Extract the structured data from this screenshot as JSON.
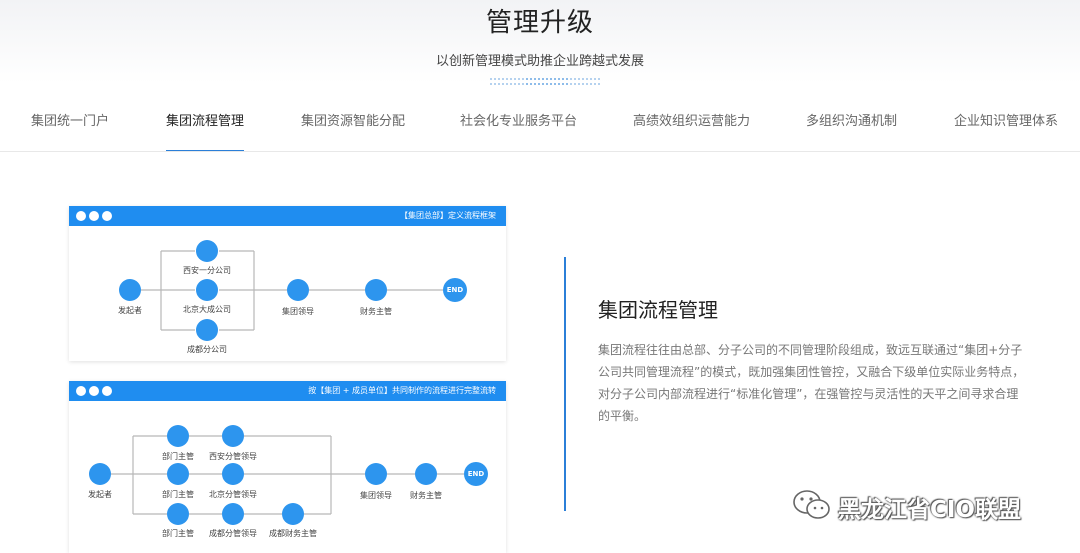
{
  "header": {
    "title": "管理升级",
    "subtitle": "以创新管理模式助推企业跨越式发展"
  },
  "tabs": [
    {
      "label": "集团统一门户",
      "active": false
    },
    {
      "label": "集团流程管理",
      "active": true
    },
    {
      "label": "集团资源智能分配",
      "active": false
    },
    {
      "label": "社会化专业服务平台",
      "active": false
    },
    {
      "label": "高绩效组织运营能力",
      "active": false
    },
    {
      "label": "多组织沟通机制",
      "active": false
    },
    {
      "label": "企业知识管理体系",
      "active": false
    }
  ],
  "diagram1": {
    "bar_title": "【集团总部】定义流程框架",
    "start_label": "发起者",
    "branches": [
      "西安一分公司",
      "北京大成公司",
      "成都分公司"
    ],
    "leader_label": "集团领导",
    "finance_label": "财务主管",
    "end_label": "END"
  },
  "diagram2": {
    "bar_title": "按【集团 + 成员单位】共同制作的流程进行完整流转",
    "start_label": "发起者",
    "row1": [
      "部门主管",
      "西安分管领导"
    ],
    "row2": [
      "部门主管",
      "北京分管领导"
    ],
    "row3": [
      "部门主管",
      "成都分管领导",
      "成都财务主管"
    ],
    "leader_label": "集团领导",
    "finance_label": "财务主管",
    "end_label": "END"
  },
  "content": {
    "title": "集团流程管理",
    "description": "集团流程往往由总部、分子公司的不同管理阶段组成，致远互联通过“集团+分子公司共同管理流程”的模式，既加强集团性管控，又融合下级单位实际业务特点，对分子公司内部流程进行“标准化管理”，在强管控与灵活性的天平之间寻求合理的平衡。"
  },
  "watermark": {
    "text": "黑龙江省CIO联盟",
    "icon": "wechat-icon"
  },
  "colors": {
    "accent": "#2b7fd8",
    "panel_bar": "#1f8df0",
    "node": "#2d95ee"
  }
}
